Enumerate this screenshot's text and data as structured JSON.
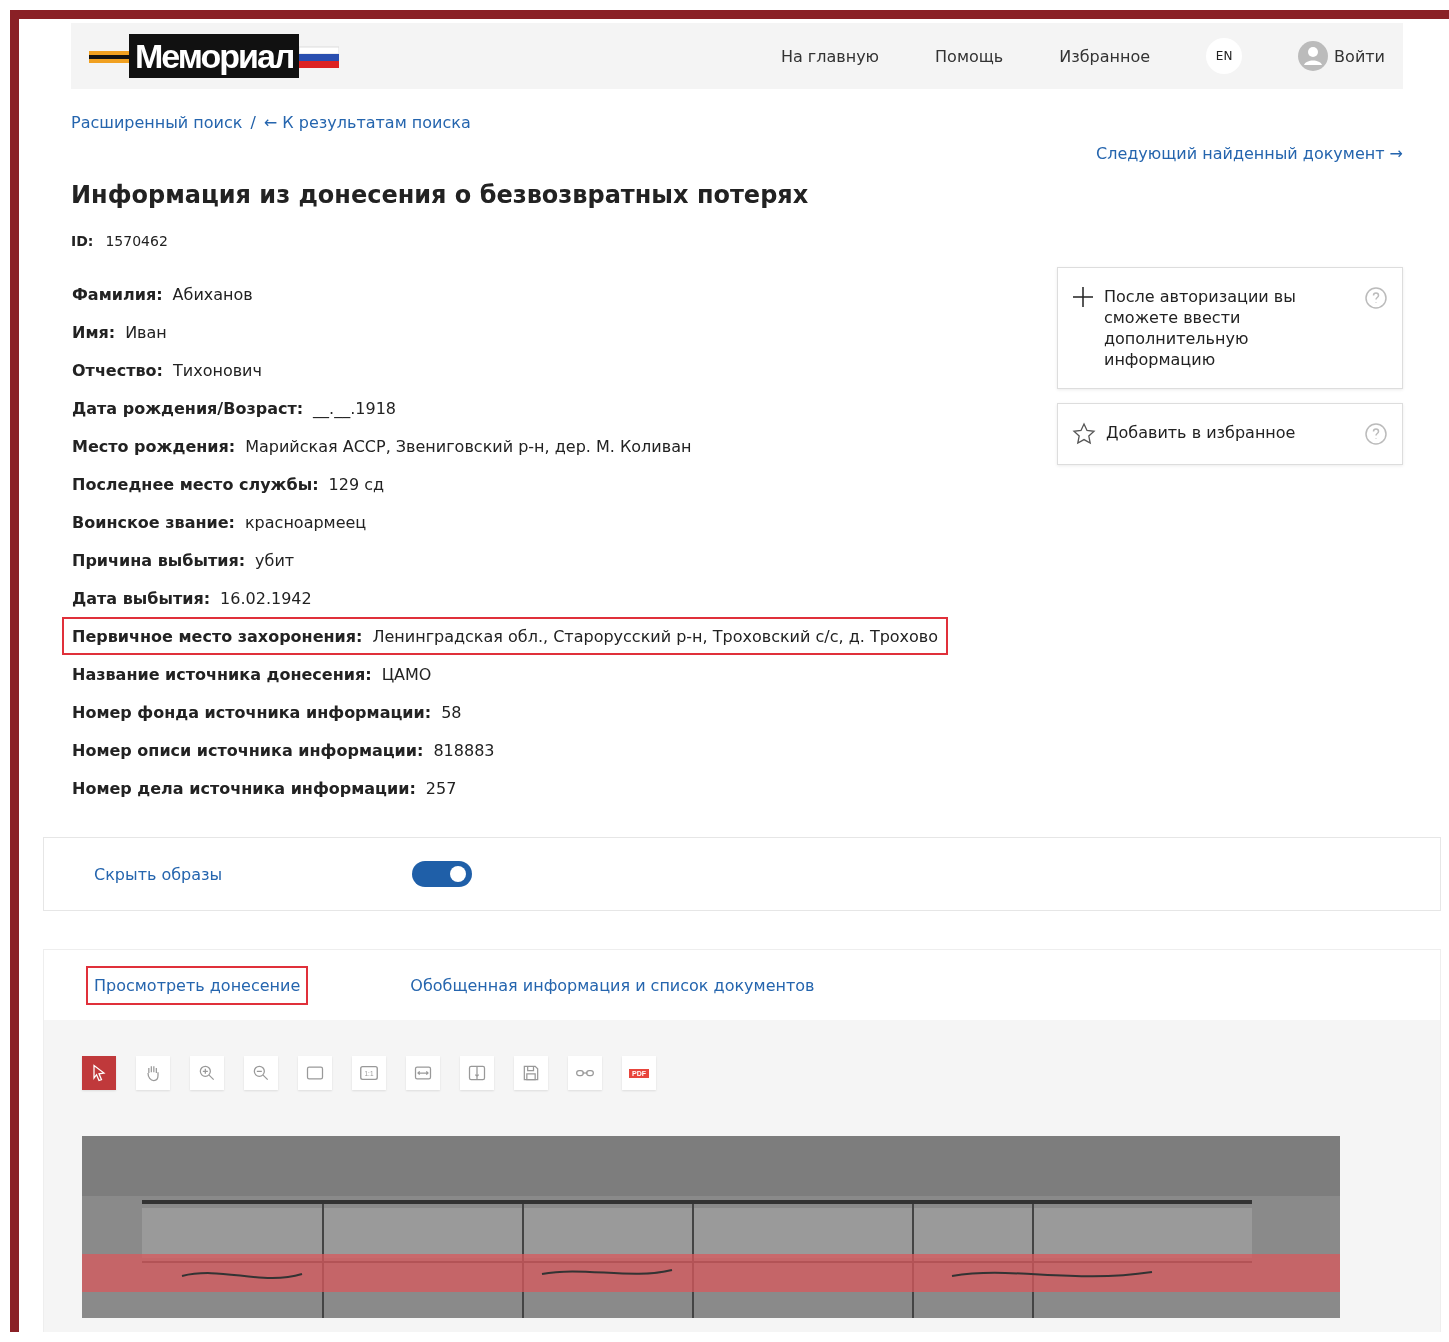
{
  "header": {
    "logo": "Мемориал",
    "nav": [
      "На главную",
      "Помощь",
      "Избранное"
    ],
    "language": "EN",
    "login": "Войти"
  },
  "breadcrumbs": {
    "items": [
      "Расширенный поиск",
      "← К результатам поиска"
    ],
    "separator": "/"
  },
  "next_link": "Следующий найденный документ →",
  "title": "Информация из донесения о безвозвратных потерях",
  "id": {
    "label": "ID:",
    "value": "1570462"
  },
  "fields": [
    {
      "label": "Фамилия:",
      "value": "Абиханов",
      "highlighted": false
    },
    {
      "label": "Имя:",
      "value": "Иван",
      "highlighted": false
    },
    {
      "label": "Отчество:",
      "value": "Тихонович",
      "highlighted": false
    },
    {
      "label": "Дата рождения/Возраст:",
      "value": "__.__.1918",
      "highlighted": false
    },
    {
      "label": "Место рождения:",
      "value": "Марийская АССР, Звениговский р-н, дер. М. Коливан",
      "highlighted": false
    },
    {
      "label": "Последнее место службы:",
      "value": "129 сд",
      "highlighted": false
    },
    {
      "label": "Воинское звание:",
      "value": "красноармеец",
      "highlighted": false
    },
    {
      "label": "Причина выбытия:",
      "value": "убит",
      "highlighted": false
    },
    {
      "label": "Дата выбытия:",
      "value": "16.02.1942",
      "highlighted": false
    },
    {
      "label": "Первичное место захоронения:",
      "value": "Ленинградская обл., Старорусский р-н, Троховский с/с, д. Трохово",
      "highlighted": true
    },
    {
      "label": "Название источника донесения:",
      "value": "ЦАМО",
      "highlighted": false
    },
    {
      "label": "Номер фонда источника информации:",
      "value": "58",
      "highlighted": false
    },
    {
      "label": "Номер описи источника информации:",
      "value": "818883",
      "highlighted": false
    },
    {
      "label": "Номер дела источника информации:",
      "value": "257",
      "highlighted": false
    }
  ],
  "side_cards": [
    {
      "kind": "add",
      "text": "После авторизации вы сможете ввести дополнительную информацию"
    },
    {
      "kind": "favorite",
      "text": "Добавить в избранное"
    }
  ],
  "images_toggle": {
    "label": "Скрыть образы",
    "on": true
  },
  "tabs": [
    {
      "label": "Просмотреть донесение",
      "highlighted": true
    },
    {
      "label": "Обобщенная информация и список документов",
      "highlighted": false
    }
  ],
  "viewer_tools": [
    {
      "kind": "pointer",
      "selected": true
    },
    {
      "kind": "hand",
      "selected": false
    },
    {
      "kind": "zoom-in",
      "selected": false
    },
    {
      "kind": "zoom-out",
      "selected": false
    },
    {
      "kind": "frame",
      "selected": false
    },
    {
      "kind": "actual-size",
      "label": "1:1",
      "selected": false
    },
    {
      "kind": "fit-width",
      "selected": false
    },
    {
      "kind": "fit-height",
      "selected": false
    },
    {
      "kind": "save",
      "selected": false
    },
    {
      "kind": "link",
      "selected": false
    },
    {
      "kind": "pdf",
      "label": "PDF",
      "selected": false
    }
  ]
}
